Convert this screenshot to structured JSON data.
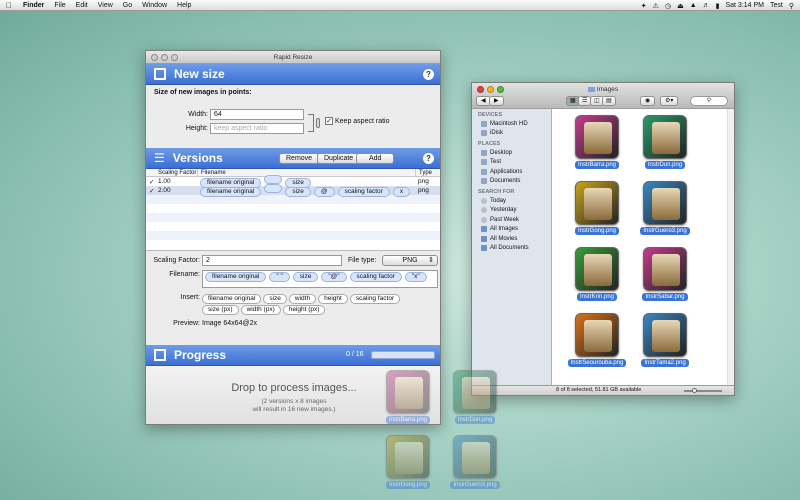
{
  "menubar": {
    "app": "Finder",
    "items": [
      "File",
      "Edit",
      "View",
      "Go",
      "Window",
      "Help"
    ],
    "clock": "Sat 3:14 PM",
    "user": "Test"
  },
  "rr": {
    "title": "Rapid Resize",
    "new_size": {
      "title": "New size",
      "subtitle": "Size of new images in points:",
      "width_label": "Width:",
      "width_value": "64",
      "height_label": "Height:",
      "height_placeholder": "keep aspect ratio",
      "keep_aspect": "Keep aspect ratio",
      "keep_aspect_checked": true
    },
    "versions": {
      "title": "Versions",
      "remove": "Remove",
      "duplicate": "Duplicate",
      "add": "Add",
      "columns": [
        "Scaling Factor",
        "Filename",
        "Type"
      ],
      "rows": [
        {
          "checked": true,
          "factor": "1.00",
          "tokens": [
            "filename original",
            "",
            "size"
          ],
          "type": "png"
        },
        {
          "checked": true,
          "factor": "2.00",
          "tokens": [
            "filename original",
            "",
            "size",
            "@",
            "scaling factor",
            "x"
          ],
          "type": "png"
        }
      ]
    },
    "detail": {
      "scaling_label": "Scaling Factor:",
      "scaling_value": "2",
      "filetype_label": "File type:",
      "filetype_value": "PNG",
      "filename_label": "Filename:",
      "filename_tokens": [
        "filename original",
        "\" \"",
        "size",
        "\"@\"",
        "scaling factor",
        "\"x\""
      ],
      "insert_label": "Insert:",
      "insert_tokens": [
        "filename original",
        "size",
        "width",
        "height",
        "scaling factor",
        "size (px)",
        "width (px)",
        "height (px)"
      ],
      "preview_label": "Preview:",
      "preview_value": "Image 64x64@2x"
    },
    "progress": {
      "title": "Progress",
      "count": "0 / 16",
      "progress_fraction": 0,
      "drop_title": "Drop to process images...",
      "drop_sub1": "(2 versions x 8 images",
      "drop_sub2": "will result in 16 new images.)"
    }
  },
  "finder": {
    "title": "Images",
    "sidebar": {
      "devices_header": "DEVICES",
      "devices": [
        "Macintosh HD",
        "iDisk"
      ],
      "places_header": "PLACES",
      "places": [
        "Desktop",
        "Test",
        "Applications",
        "Documents"
      ],
      "search_header": "SEARCH FOR",
      "search": [
        "Today",
        "Yesterday",
        "Past Week",
        "All Images",
        "All Movies",
        "All Documents"
      ]
    },
    "files": [
      {
        "name": "InstrBarra.png",
        "color": "#c23c8c"
      },
      {
        "name": "InstrDun.png",
        "color": "#2a9a6a"
      },
      {
        "name": "InstrGong.png",
        "color": "#c9a21e"
      },
      {
        "name": "InstrGuero3.png",
        "color": "#3a86c2"
      },
      {
        "name": "InstrKrin.png",
        "color": "#3a9a3a"
      },
      {
        "name": "InstrSabar.png",
        "color": "#c23c8c"
      },
      {
        "name": "InstrSeourouba.png",
        "color": "#d9711c"
      },
      {
        "name": "InstrTama2.png",
        "color": "#3a86c2"
      }
    ],
    "status": "8 of 8 selected, 51.81 GB available"
  },
  "drag": [
    "InstrBarra.png",
    "InstrDun.png",
    "InstrGong.png",
    "InstrGuero3.png"
  ]
}
